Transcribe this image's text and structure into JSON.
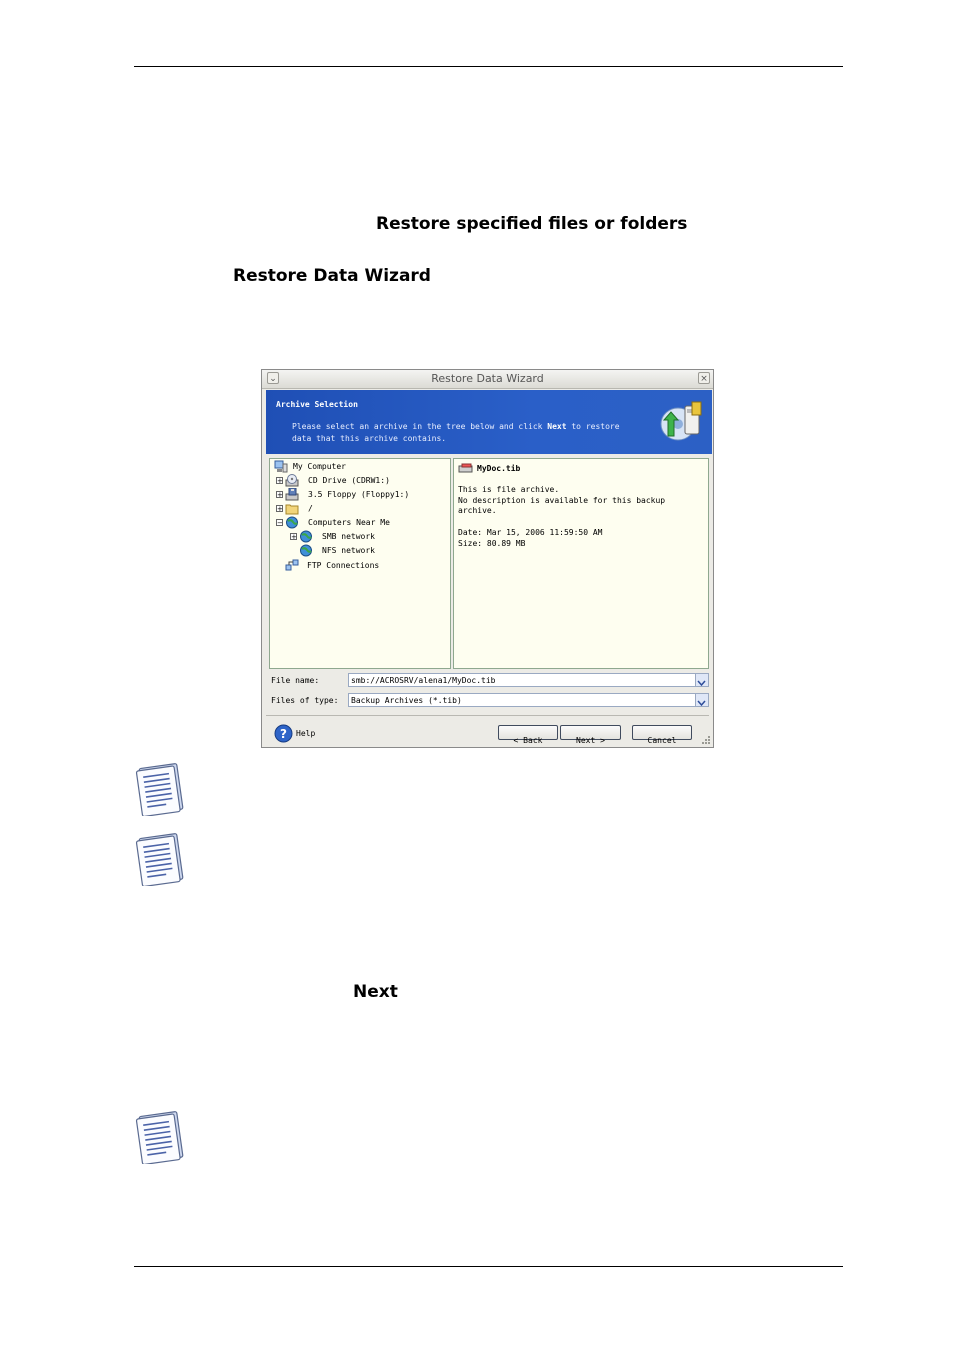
{
  "page": {
    "heading_fragment": "Restore specified files or folders",
    "wizard_name": "Restore Data Wizard",
    "next_label": "Next"
  },
  "dialog": {
    "title": "Restore Data Wizard",
    "banner": {
      "heading": "Archive Selection",
      "desc_pre": "Please select an archive in the tree below and click ",
      "desc_bold": "Next",
      "desc_post": " to restore data that this archive contains."
    },
    "tree": [
      {
        "label": "My Computer",
        "icon": "computer-icon",
        "expander": ""
      },
      {
        "label": "CD Drive (CDRW1:)",
        "icon": "cd-drive-icon",
        "expander": "+"
      },
      {
        "label": "3.5 Floppy (Floppy1:)",
        "icon": "floppy-icon",
        "expander": "+"
      },
      {
        "label": "/",
        "icon": "folder-icon",
        "expander": "+"
      },
      {
        "label": "Computers Near Me",
        "icon": "network-globe-icon",
        "expander": "−"
      },
      {
        "label": "SMB network",
        "icon": "network-globe-icon",
        "expander": "+"
      },
      {
        "label": "NFS network",
        "icon": "network-globe-icon",
        "expander": ""
      },
      {
        "label": "FTP Connections",
        "icon": "ftp-icon",
        "expander": ""
      }
    ],
    "info": {
      "filename": "MyDoc.tib",
      "line1": "This is file archive.",
      "line2": "No description is available for this backup",
      "line3": "archive.",
      "date": "Date: Mar 15, 2006 11:59:50 AM",
      "size": "Size: 80.89 MB"
    },
    "file_name_label": "File name:",
    "file_name_value": "smb://ACROSRV/alena1/MyDoc.tib",
    "file_type_label": "Files of type:",
    "file_type_value": "Backup Archives (*.tib)",
    "help_label": "Help",
    "back_label": "< Back",
    "next_label": "Next >",
    "cancel_label": "Cancel"
  }
}
